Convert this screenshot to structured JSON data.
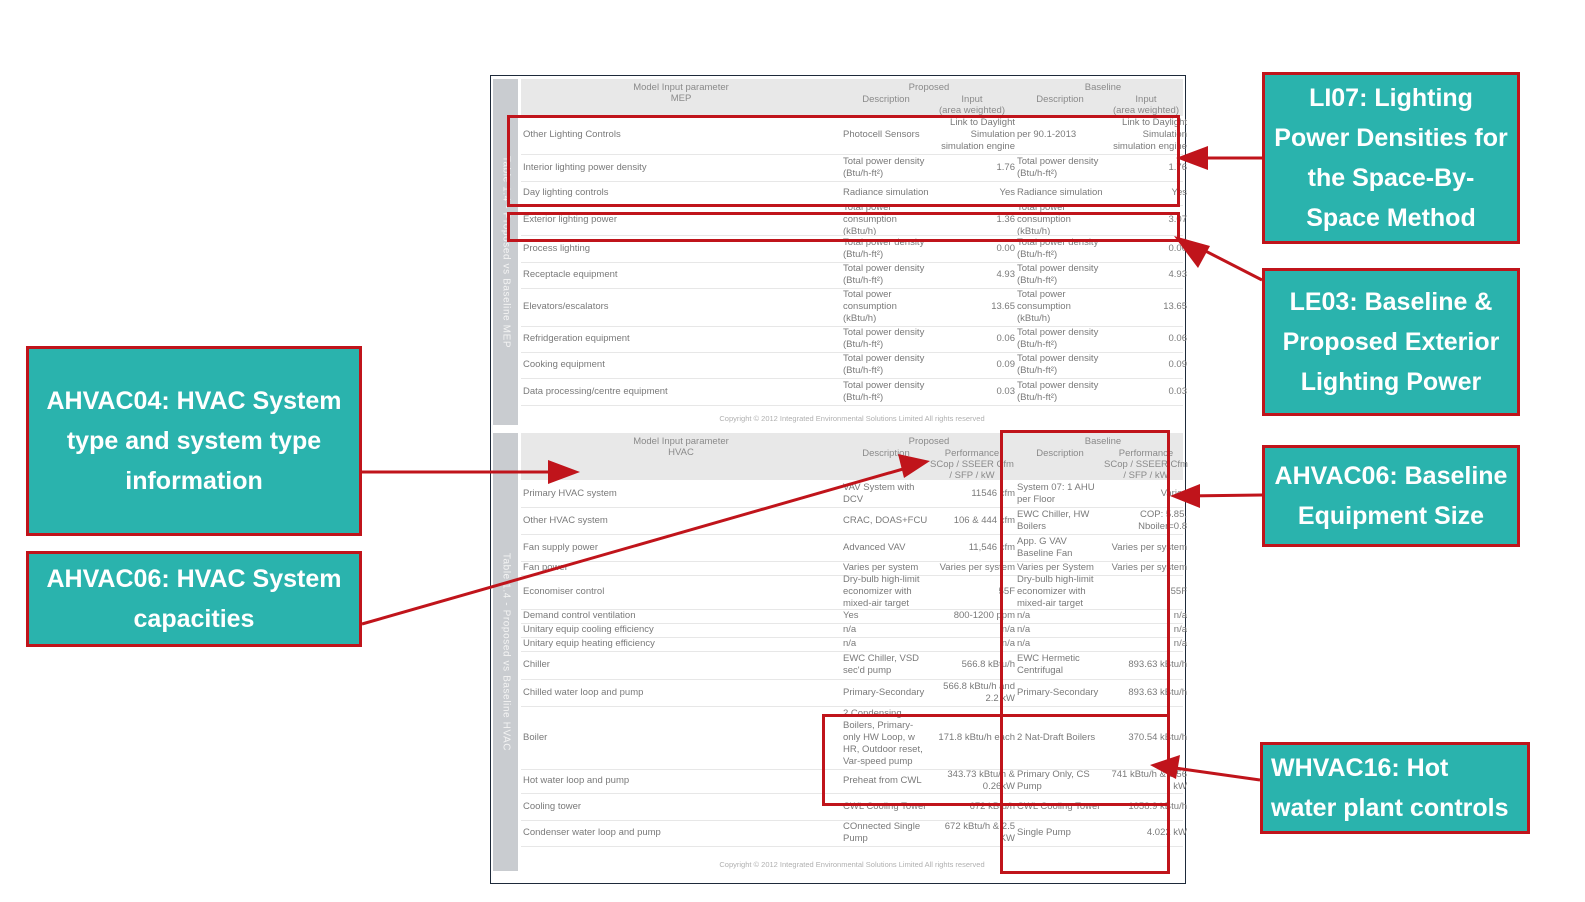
{
  "mep_table": {
    "side_label": "Table 1.4 - Proposed vs Baseline MEP",
    "header": {
      "param": "Model Input parameter",
      "param_sub": "MEP",
      "proposed": "Proposed",
      "baseline": "Baseline",
      "desc_p": "Description",
      "input_p": "Input",
      "input_p_sub": "(area weighted)",
      "desc_b": "Description",
      "input_b": "Input",
      "input_b_sub": "(area weighted)"
    },
    "rows": [
      [
        "Other Lighting Controls",
        "Photocell Sensors",
        "Link to Daylight Simulation simulation engine",
        "per 90.1-2013",
        "Link to Daylight Simulation simulation engine"
      ],
      [
        "Interior lighting power density",
        "Total power density (Btu/h-ft²)",
        "1.76",
        "Total power density (Btu/h-ft²)",
        "1.76"
      ],
      [
        "Day lighting controls",
        "Radiance simulation",
        "Yes",
        "Radiance simulation",
        "Yes"
      ],
      [
        "Exterior lighting power",
        "Total power consumption (kBtu/h)",
        "1.36",
        "Total power consumption (kBtu/h)",
        "3.07"
      ],
      [
        "Process lighting",
        "Total power density (Btu/h-ft²)",
        "0.00",
        "Total power density (Btu/h-ft²)",
        "0.00"
      ],
      [
        "Receptacle equipment",
        "Total power density (Btu/h-ft²)",
        "4.93",
        "Total power density (Btu/h-ft²)",
        "4.93"
      ],
      [
        "Elevators/escalators",
        "Total power consumption (kBtu/h)",
        "13.65",
        "Total power consumption (kBtu/h)",
        "13.65"
      ],
      [
        "Refridgeration equipment",
        "Total power density (Btu/h-ft²)",
        "0.06",
        "Total power density (Btu/h-ft²)",
        "0.06"
      ],
      [
        "Cooking equipment",
        "Total power density (Btu/h-ft²)",
        "0.09",
        "Total power density (Btu/h-ft²)",
        "0.09"
      ],
      [
        "Data processing/centre equipment",
        "Total power density (Btu/h-ft²)",
        "0.03",
        "Total power density (Btu/h-ft²)",
        "0.03"
      ]
    ],
    "copyright": "Copyright © 2012 Integrated Environmental Solutions Limited All rights reserved"
  },
  "hvac_table": {
    "side_label": "Table 1.4 - Proposed vs Baseline HVAC",
    "header": {
      "param": "Model Input parameter",
      "param_sub": "HVAC",
      "proposed": "Proposed",
      "baseline": "Baseline",
      "desc_p": "Description",
      "perf_p": "Performance",
      "perf_p_sub": "SCop / SSEER Cfm / SFP / kW",
      "desc_b": "Description",
      "perf_b": "Performance",
      "perf_b_sub": "SCop / SSEER Cfm / SFP / kW"
    },
    "rows": [
      [
        "Primary HVAC system",
        "VAV System with DCV",
        "11546 cfm",
        "System 07: 1 AHU per Floor",
        "Varies"
      ],
      [
        "Other HVAC system",
        "CRAC, DOAS+FCU",
        "106 & 444 cfm",
        "EWC Chiller, HW Boilers",
        "COP: 5.85, Nboiler=0.8"
      ],
      [
        "Fan supply power",
        "Advanced VAV",
        "11,546 cfm",
        "App. G VAV Baseline Fan",
        "Varies per system"
      ],
      [
        "Fan power",
        "Varies per system",
        "Varies per system",
        "Varies per System",
        "Varies per system"
      ],
      [
        "Economiser control",
        "Dry-bulb high-limit economizer with mixed-air target",
        "55F",
        "Dry-bulb high-limit economizer with mixed-air target",
        "55F"
      ],
      [
        "Demand control ventilation",
        "Yes",
        "800-1200 ppm",
        "n/a",
        "n/a"
      ],
      [
        "Unitary equip cooling efficiency",
        "n/a",
        "n/a",
        "n/a",
        "n/a"
      ],
      [
        "Unitary equip heating efficiency",
        "n/a",
        "n/a",
        "n/a",
        "n/a"
      ],
      [
        "Chiller",
        "EWC Chiller, VSD sec'd pump",
        "566.8 kBtu/h",
        "EWC Hermetic Centrifugal",
        "893.63 kBtu/h"
      ],
      [
        "Chilled water loop and pump",
        "Primary-Secondary",
        "566.8 kBtu/h and 2.2 kW",
        "Primary-Secondary",
        "893.63 kBtu/h"
      ],
      [
        "Boiler",
        "2 Condensing Boilers, Primary-only HW Loop, w HR, Outdoor reset, Var-speed pump",
        "171.8 kBtu/h each",
        "2 Nat-Draft Boilers",
        "370.54 kBtu/h"
      ],
      [
        "Hot water loop and pump",
        "Preheat from CWL",
        "343.73 kBtu/h & 0.26kW",
        "Primary Only, CS Pump",
        "741 kBtu/h & 0.56 kW"
      ],
      [
        "Cooling tower",
        "CWL Cooling Tower",
        "672 kBtu/h",
        "CWL Cooling Tower",
        "1058.9 kBtu/h"
      ],
      [
        "Condenser water loop and pump",
        "COnnected Single Pump",
        "672 kBtu/h & 2.5 KW",
        "Single Pump",
        "4.022 kW"
      ]
    ],
    "copyright": "Copyright © 2012 Integrated Environmental Solutions Limited All rights reserved"
  },
  "callouts": {
    "li07": "LI07: Lighting Power Densities for the Space-By-Space Method",
    "le03": "LE03: Baseline & Proposed Exterior Lighting Power",
    "ahvac04": "AHVAC04: HVAC System type and system type information",
    "ahvac06_base": "AHVAC06: Baseline Equipment Size",
    "ahvac06_cap": "AHVAC06: HVAC System capacities",
    "whvac16": "WHVAC16: Hot water plant controls"
  },
  "colors": {
    "callout_fill": "#2ab3ad",
    "callout_border": "#c0141b",
    "arrow": "#c0141b"
  }
}
